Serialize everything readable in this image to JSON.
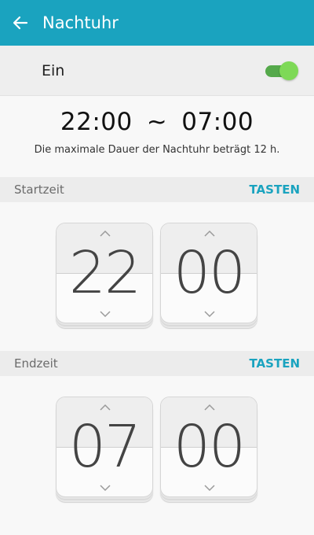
{
  "appbar": {
    "title": "Nachtuhr",
    "back_icon": "arrow-left-icon"
  },
  "toggle": {
    "label": "Ein",
    "state": "on",
    "track_color": "#55a94b",
    "thumb_color": "#7ed957"
  },
  "summary": {
    "start": "22:00",
    "separator": "~",
    "end": "07:00",
    "note": "Die maximale Dauer der Nachtuhr beträgt 12 h."
  },
  "start_section": {
    "label": "Startzeit",
    "button": "TASTEN",
    "hour": "22",
    "minute": "00"
  },
  "end_section": {
    "label": "Endzeit",
    "button": "TASTEN",
    "hour": "07",
    "minute": "00"
  },
  "colors": {
    "accent": "#1aa3bf",
    "toggle_on": "#7ed957"
  }
}
